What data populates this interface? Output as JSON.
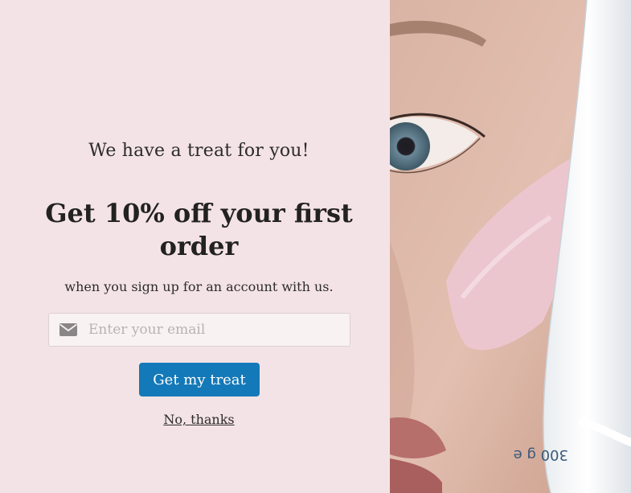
{
  "popup": {
    "eyebrow": "We have a treat for you!",
    "headline": "Get 10% off your first order",
    "subtext": "when you sign up for an account with us.",
    "email_placeholder": "Enter your email",
    "email_icon": "envelope-icon",
    "cta_label": "Get my treat",
    "decline_label": "No, thanks"
  },
  "image": {
    "tube_text": "300 g e"
  },
  "colors": {
    "panel_bg": "#f4e3e6",
    "cta_bg": "#1479b8",
    "cta_text": "#ffffff",
    "text": "#222222"
  }
}
